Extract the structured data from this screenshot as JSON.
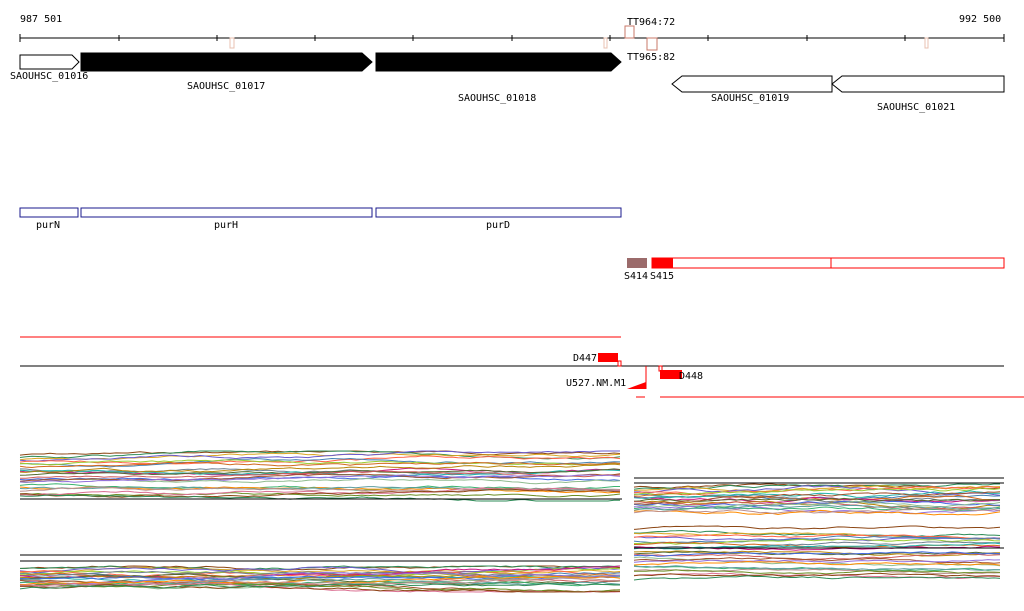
{
  "browser": {
    "range_start": "987 501",
    "range_end": "992 500"
  },
  "terminators": [
    {
      "label": "TT964:72"
    },
    {
      "label": "TT965:82"
    }
  ],
  "genes": [
    {
      "label": "SAOUHSC_01016",
      "strand": "+",
      "style": "outline"
    },
    {
      "label": "SAOUHSC_01017",
      "strand": "+",
      "style": "filled"
    },
    {
      "label": "SAOUHSC_01018",
      "strand": "+",
      "style": "filled"
    },
    {
      "label": "SAOUHSC_01019",
      "strand": "-",
      "style": "outline"
    },
    {
      "label": "SAOUHSC_01021",
      "strand": "-",
      "style": "outline"
    }
  ],
  "gene_names": [
    {
      "label": "purN"
    },
    {
      "label": "purH"
    },
    {
      "label": "purD"
    }
  ],
  "segments": [
    {
      "label": "S414"
    },
    {
      "label": "S415"
    }
  ],
  "features": [
    {
      "label": "D447"
    },
    {
      "label": "U527.NM.M1"
    },
    {
      "label": "D448"
    }
  ],
  "colors": {
    "gene_fill": "#000000",
    "gene_name_box": "#1a1a8c",
    "segment_red": "#ff0000",
    "segment_brown": "#9b6b6b",
    "terminator": "#c87a6a"
  }
}
